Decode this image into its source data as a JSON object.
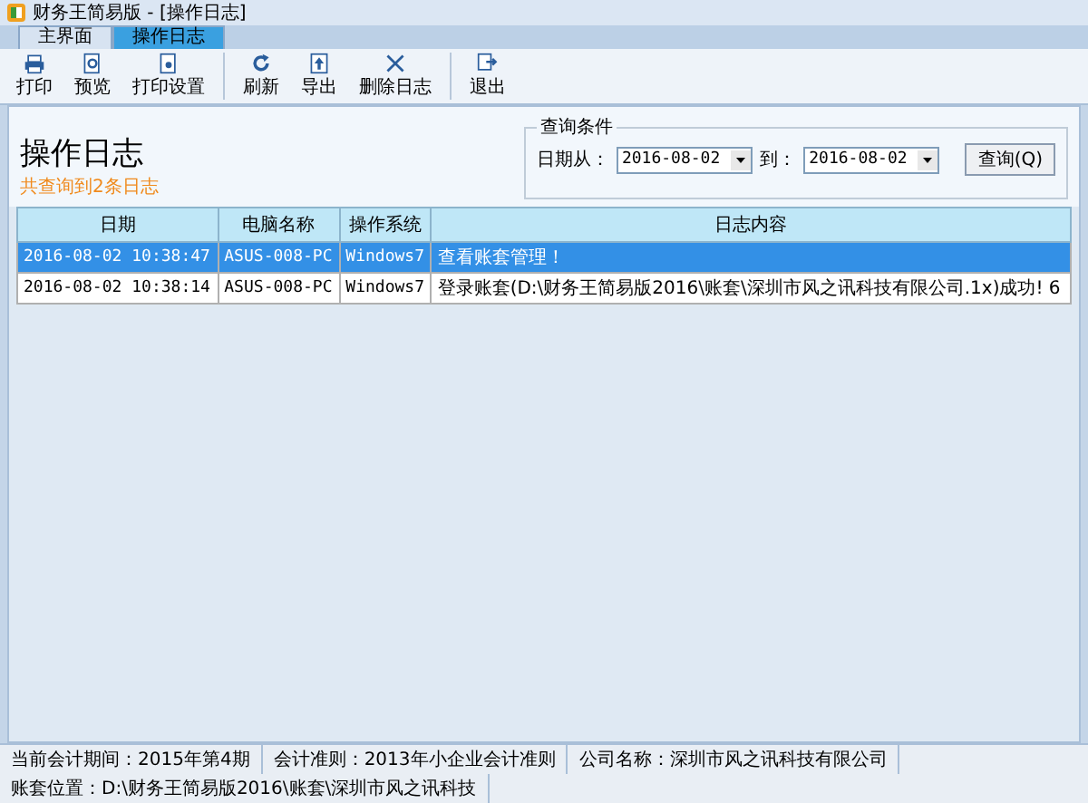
{
  "window": {
    "title": "财务王简易版 - [操作日志]"
  },
  "tabs": [
    {
      "label": "主界面",
      "selected": false
    },
    {
      "label": "操作日志",
      "selected": true
    }
  ],
  "toolbar": [
    {
      "kind": "button",
      "label": "打印"
    },
    {
      "kind": "button",
      "label": "预览"
    },
    {
      "kind": "button",
      "label": "打印设置"
    },
    {
      "kind": "separator"
    },
    {
      "kind": "button",
      "label": "刷新"
    },
    {
      "kind": "button",
      "label": "导出"
    },
    {
      "kind": "button",
      "label": "删除日志"
    },
    {
      "kind": "separator"
    },
    {
      "kind": "button",
      "label": "退出"
    }
  ],
  "header": {
    "title": "操作日志",
    "summary": "共查询到2条日志"
  },
  "query": {
    "legend": "查询条件",
    "from_label": "日期从：",
    "from_value": "2016-08-02",
    "to_label": "到：",
    "to_value": "2016-08-02",
    "button": "查询(Q)"
  },
  "table": {
    "columns": [
      "日期",
      "电脑名称",
      "操作系统",
      "日志内容"
    ],
    "rows": [
      {
        "selected": true,
        "cells": [
          "2016-08-02 10:38:47",
          "ASUS-008-PC",
          "Windows7",
          "查看账套管理！"
        ]
      },
      {
        "selected": false,
        "cells": [
          "2016-08-02 10:38:14",
          "ASUS-008-PC",
          "Windows7",
          "登录账套(D:\\财务王简易版2016\\账套\\深圳市风之讯科技有限公司.1x)成功! 6"
        ]
      }
    ]
  },
  "status_bar": [
    "当前会计期间：2015年第4期",
    "会计准则：2013年小企业会计准则",
    "公司名称：深圳市风之讯科技有限公司",
    "账套位置：D:\\财务王简易版2016\\账套\\深圳市风之讯科技"
  ]
}
